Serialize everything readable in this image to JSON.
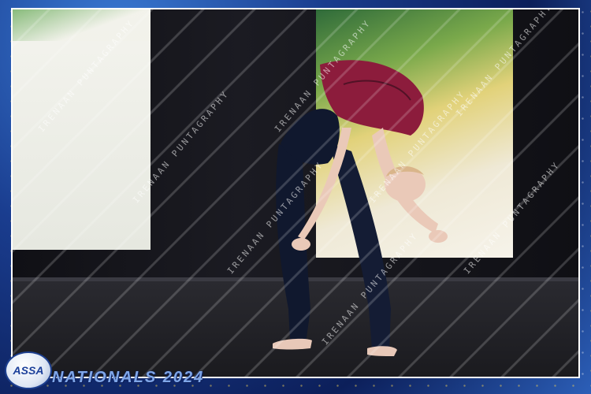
{
  "photo": {
    "scene": "Dancer performing a backbend on a dark stage"
  },
  "watermark": {
    "text": "IRENAAN PUNTAGRAPHY"
  },
  "branding": {
    "logo_text": "ASSA",
    "event_title": "NATIONALS 2024"
  },
  "colors": {
    "frame": "#1a3d8f",
    "costume_top": "#8c1c3c",
    "costume_legs": "#101830"
  }
}
